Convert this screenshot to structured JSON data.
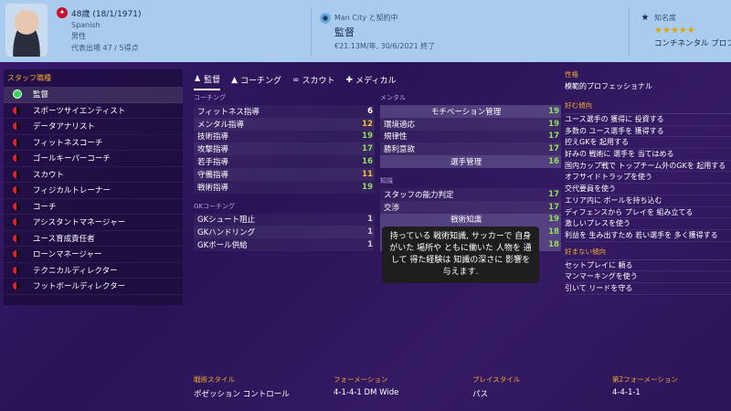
{
  "header": {
    "age_dob": "48歳 (18/1/1971)",
    "nationality": "Spanish",
    "gender": "男性",
    "caps": "代表出場 47 / 5得点",
    "club_contract": "Man City と契約中",
    "role": "監督",
    "wage_contract": "€21.13M/年, 30/6/2021 終了",
    "reputation_label": "知名度",
    "reputation_stars": 5,
    "reputation_text": "コンチネンタル プロファイ",
    "colors": {
      "header_bg": "#a9cbee",
      "star": "#e0a800",
      "accent": "#f0a830"
    }
  },
  "sidebar": {
    "title": "スタッフ職種",
    "items": [
      "監督",
      "スポーツサイエンティスト",
      "データアナリスト",
      "フィットネスコーチ",
      "ゴールキーパーコーチ",
      "スカウト",
      "フィジカルトレーナー",
      "コーチ",
      "アシスタントマネージャー",
      "ユース育成責任者",
      "ローンマネージャー",
      "テクニカルディレクター",
      "フットボールディレクター"
    ]
  },
  "tabs": [
    {
      "label": "監督",
      "icon": "manager-icon",
      "glyph": "♟"
    },
    {
      "label": "コーチング",
      "icon": "cone-icon",
      "glyph": "▲"
    },
    {
      "label": "スカウト",
      "icon": "binoculars-icon",
      "glyph": "∞"
    },
    {
      "label": "メディカル",
      "icon": "medical-icon",
      "glyph": "✚"
    }
  ],
  "coaching": {
    "title": "コーチング",
    "attrs": [
      {
        "name": "フィットネス指導",
        "value": 6,
        "color": "white"
      },
      {
        "name": "メンタル指導",
        "value": 12,
        "color": "yellow"
      },
      {
        "name": "技術指導",
        "value": 19,
        "color": "green"
      },
      {
        "name": "攻撃指導",
        "value": 17,
        "color": "green"
      },
      {
        "name": "若手指導",
        "value": 16,
        "color": "green"
      },
      {
        "name": "守備指導",
        "value": 11,
        "color": "yellow"
      },
      {
        "name": "戦術指導",
        "value": 19,
        "color": "green"
      }
    ]
  },
  "gk_coaching": {
    "title": "GKコーチング",
    "attrs": [
      {
        "name": "GKシュート阻止",
        "value": 1,
        "color": "light"
      },
      {
        "name": "GKハンドリング",
        "value": 1,
        "color": "light"
      },
      {
        "name": "GKボール供給",
        "value": 1,
        "color": "light"
      }
    ]
  },
  "mental": {
    "title": "メンタル",
    "attrs": [
      {
        "name": "モチベーション管理",
        "value": 19,
        "color": "green",
        "hl": true
      },
      {
        "name": "環境適応",
        "value": 19,
        "color": "green",
        "hl": false
      },
      {
        "name": "規律性",
        "value": 17,
        "color": "green",
        "hl": false
      },
      {
        "name": "勝利意欲",
        "value": 17,
        "color": "green",
        "hl": false
      },
      {
        "name": "選手管理",
        "value": 16,
        "color": "green",
        "hl": true
      }
    ]
  },
  "knowledge": {
    "title": "知識",
    "attrs": [
      {
        "name": "スタッフの能力判定",
        "value": 17,
        "color": "green",
        "hl": false
      },
      {
        "name": "交渉",
        "value": 17,
        "color": "green",
        "hl": false
      },
      {
        "name": "戦術知識",
        "value": 19,
        "color": "green",
        "hl": true
      },
      {
        "name": "若手選手の才能判定",
        "value": 18,
        "color": "green",
        "hl": true
      },
      {
        "name": "選手の能力判定",
        "value": 18,
        "color": "green",
        "hl": true
      }
    ]
  },
  "tooltip": {
    "text": "持っている 戦術知識, サッカーで 自身がいた 場所や ともに働いた 人物を 通して 得た経験は 知識の深さに 影響を 与えます."
  },
  "personality": {
    "title": "性格",
    "value": "模範的プロフェッショナル"
  },
  "preferences": {
    "title": "好む傾向",
    "items": [
      "ユース選手の 獲得に 投資する",
      "多数の ユース選手を 獲得する",
      "控えGKを 起用する",
      "好みの 戦術に 選手を 当てはめる",
      "国内カップ戦で トップチーム外のGKを 起用する",
      "オフサイドトラップを使う",
      "交代要員を使う",
      "エリア内に ボールを持ち込む",
      "ディフェンスから プレイを 組み立てる",
      "激しいプレスを使う",
      "利益を 生み出すため 若い選手を 多く獲得する"
    ]
  },
  "dislikes": {
    "title": "好まない傾向",
    "items": [
      "セットプレイに 頼る",
      "マンマーキングを使う",
      "引いて リードを守る"
    ]
  },
  "bottom": {
    "tactical_style_label": "戦術スタイル",
    "tactical_style_value": "ポゼッション コントロール",
    "formation_label": "フォーメーション",
    "formation_value": "4-1-4-1 DM Wide",
    "play_style_label": "プレイスタイル",
    "play_style_value": "パス",
    "second_formation_label": "第2フォーメーション",
    "second_formation_value": "4-4-1-1"
  }
}
